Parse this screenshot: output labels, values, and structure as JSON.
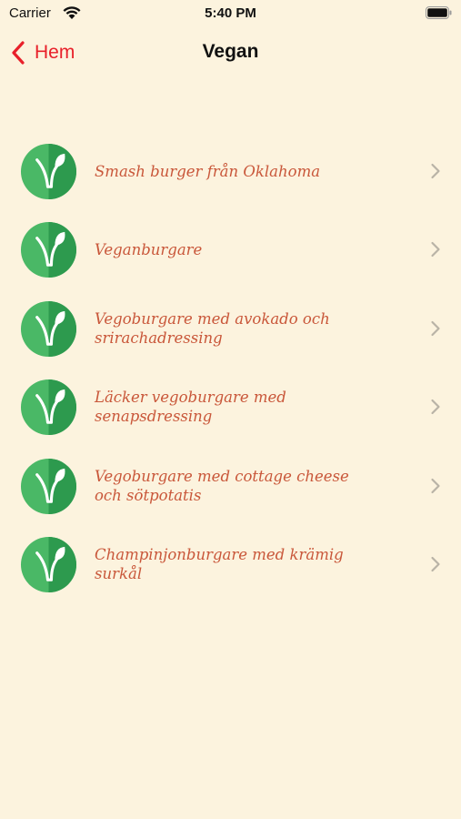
{
  "status_bar": {
    "carrier": "Carrier",
    "time": "5:40 PM"
  },
  "nav": {
    "back_label": "Hem",
    "title": "Vegan",
    "accent_color": "#e8202a"
  },
  "recipes": [
    {
      "title": "Smash burger från Oklahoma"
    },
    {
      "title": "Veganburgare"
    },
    {
      "title": "Vegoburgare med avokado och srirachadressing"
    },
    {
      "title": "Läcker vegoburgare med senapsdressing"
    },
    {
      "title": "Vegoburgare med cottage cheese och sötpotatis"
    },
    {
      "title": "Champinjonburgare med krämig surkål"
    }
  ],
  "colors": {
    "background": "#fcf3de",
    "recipe_text": "#c9573a",
    "icon_green": "#4ab866"
  },
  "icons": {
    "row_icon": "vegan-sprout-icon",
    "row_chevron": "chevron-right-icon",
    "back": "chevron-left-icon"
  }
}
